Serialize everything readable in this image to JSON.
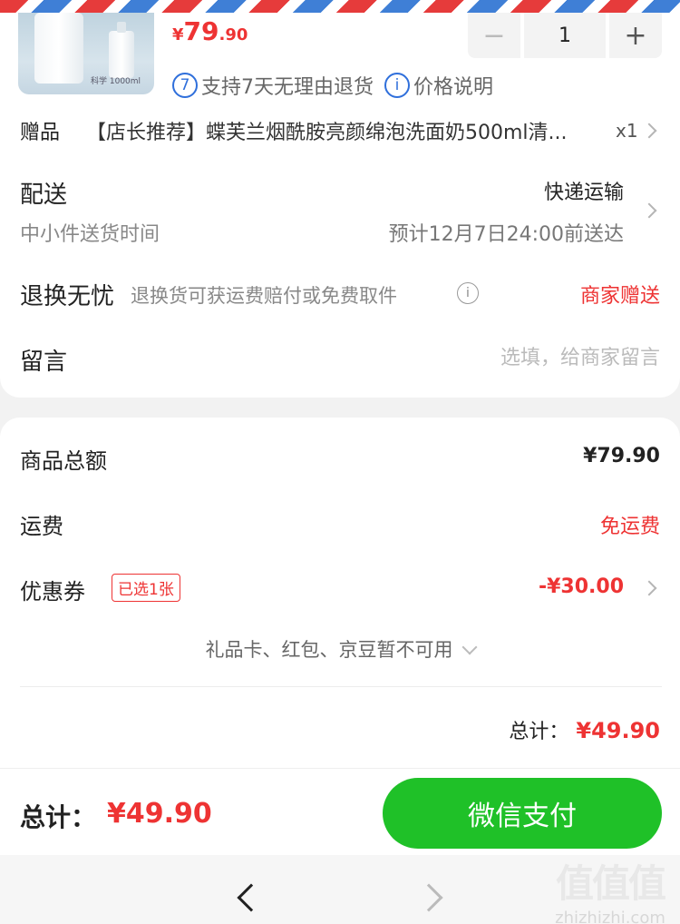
{
  "product": {
    "price_currency": "¥",
    "price_integer": "79",
    "price_decimal": ".90",
    "image_caption": "科学 1000ml",
    "quantity": "1",
    "minus_label": "−",
    "plus_label": "+",
    "tag_return_icon": "7",
    "tag_return": "支持7天无理由退货",
    "tag_price_icon": "i",
    "tag_price": "价格说明"
  },
  "gift": {
    "label": "赠品",
    "text": "【店长推荐】蝶芙兰烟酰胺亮颜绵泡洗面奶500ml清...",
    "qty": "x1"
  },
  "delivery": {
    "title": "配送",
    "subtitle": "中小件送货时间",
    "method": "快递运输",
    "eta": "预计12月7日24:00前送达"
  },
  "returns": {
    "title": "退换无忧",
    "desc": "退换货可获运费赔付或免费取件",
    "info_icon": "i",
    "gift_status": "商家赠送"
  },
  "message": {
    "label": "留言",
    "placeholder": "选填，给商家留言"
  },
  "summary": {
    "goods_label": "商品总额",
    "goods_value": "¥79.90",
    "shipping_label": "运费",
    "shipping_value": "免运费",
    "coupon_label": "优惠券",
    "coupon_badge": "已选1张",
    "coupon_value": "-¥30.00",
    "unavailable": "礼品卡、红包、京豆暂不可用",
    "total_label": "总计：",
    "total_value": "¥49.90"
  },
  "bottom_bar": {
    "total_label": "总计：",
    "total_value": "¥49.90",
    "pay_button": "微信支付"
  },
  "watermark": {
    "logo": "值值值",
    "text": "zhizhizhi.com"
  },
  "colors": {
    "accent_red": "#e33333",
    "pay_green": "#1fc128",
    "link_blue": "#2f6fdb"
  },
  "icons": [
    "chevron-right-icon",
    "chevron-down-icon",
    "info-icon",
    "back-icon",
    "forward-icon",
    "return-7days-icon"
  ]
}
